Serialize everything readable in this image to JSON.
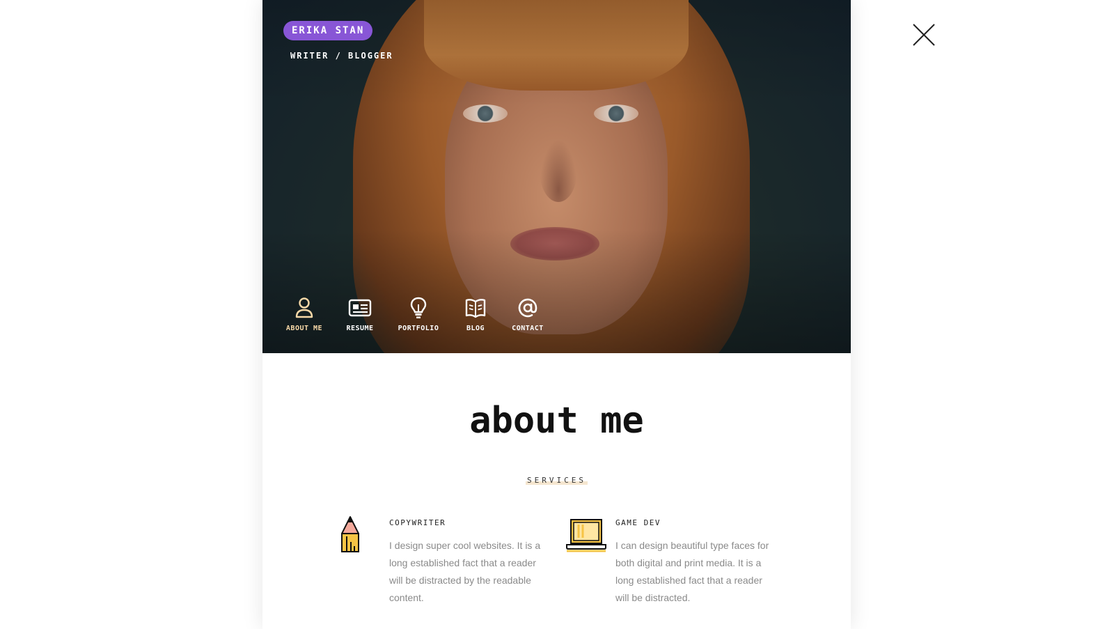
{
  "profile": {
    "name": "ERIKA STAN",
    "tagline": "WRITER / BLOGGER"
  },
  "nav": {
    "items": [
      {
        "label": "ABOUT ME",
        "icon": "person-icon",
        "active": true
      },
      {
        "label": "RESUME",
        "icon": "id-card-icon",
        "active": false
      },
      {
        "label": "PORTFOLIO",
        "icon": "lightbulb-icon",
        "active": false
      },
      {
        "label": "BLOG",
        "icon": "open-book-icon",
        "active": false
      },
      {
        "label": "CONTACT",
        "icon": "at-sign-icon",
        "active": false
      }
    ]
  },
  "close": {
    "icon": "close-icon"
  },
  "main": {
    "title": "about me",
    "section_label": "SERVICES",
    "services": [
      {
        "title": "COPYWRITER",
        "icon": "pencil-icon",
        "text": "I design super cool websites. It is a long established fact that a reader will be distracted by the readable content."
      },
      {
        "title": "GAME DEV",
        "icon": "laptop-icon",
        "text": "I can design beautiful type faces for both digital and print media. It is a long established fact that a reader will be distracted."
      }
    ]
  },
  "colors": {
    "accent": "#8856d6",
    "nav_active": "#f8d9a8",
    "icon_yellow": "#f6c445",
    "icon_pink": "#f4a99c"
  }
}
